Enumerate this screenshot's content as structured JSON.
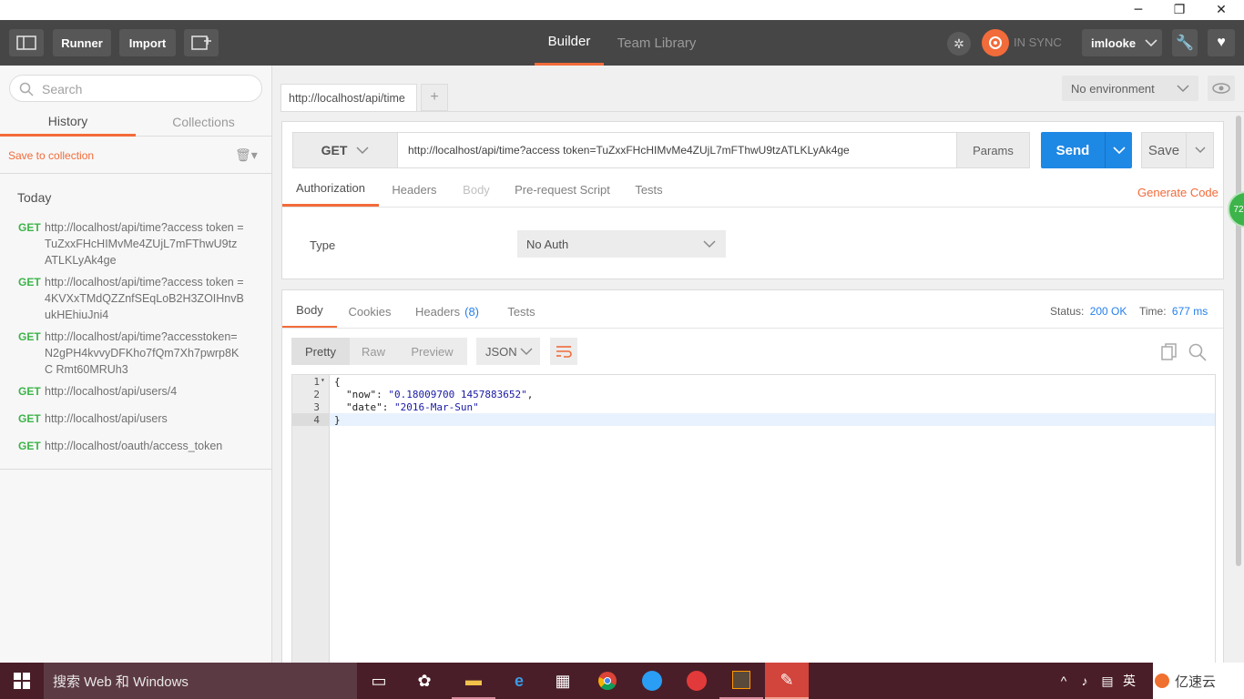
{
  "window": {
    "minimize": "─",
    "maximize": "❐",
    "close": "✕"
  },
  "header": {
    "runner": "Runner",
    "import": "Import",
    "tab_builder": "Builder",
    "tab_team_library": "Team Library",
    "sync": "IN SYNC",
    "user": "imlooke"
  },
  "sidebar": {
    "search_placeholder": "Search",
    "tab_history": "History",
    "tab_collections": "Collections",
    "save_to_collection": "Save to collection",
    "group_today": "Today",
    "items": [
      {
        "method": "GET",
        "url": "http://localhost/api/time?access token =TuZxxFHcHIMvMe4ZUjL7mFThwU9tz ATLKLyAk4ge"
      },
      {
        "method": "GET",
        "url": "http://localhost/api/time?access token =4KVXxTMdQZZnfSEqLoB2H3ZOIHnvB ukHEhiuJni4"
      },
      {
        "method": "GET",
        "url": "http://localhost/api/time?accesstoken= N2gPH4kvvyDFKho7fQm7Xh7pwrp8KC Rmt60MRUh3"
      },
      {
        "method": "GET",
        "url": "http://localhost/api/users/4"
      },
      {
        "method": "GET",
        "url": "http://localhost/api/users"
      },
      {
        "method": "GET",
        "url": "http://localhost/oauth/access_token"
      }
    ]
  },
  "request": {
    "tab_label": "http://localhost/api/time",
    "add_tab": "+",
    "environment": "No environment",
    "method": "GET",
    "url": "http://localhost/api/time?access token=TuZxxFHcHIMvMe4ZUjL7mFThwU9tzATLKLyAk4ge",
    "params": "Params",
    "send": "Send",
    "save": "Save",
    "tabs": {
      "authorization": "Authorization",
      "headers": "Headers",
      "body": "Body",
      "prerequest": "Pre-request Script",
      "tests": "Tests"
    },
    "generate_code": "Generate Code",
    "type_label": "Type",
    "auth_type": "No Auth"
  },
  "response": {
    "tabs": {
      "body": "Body",
      "cookies": "Cookies",
      "headers": "Headers",
      "headers_count": "(8)",
      "tests": "Tests"
    },
    "status_label": "Status:",
    "status_value": "200 OK",
    "time_label": "Time:",
    "time_value": "677 ms",
    "view_pretty": "Pretty",
    "view_raw": "Raw",
    "view_preview": "Preview",
    "format": "JSON",
    "lines": [
      {
        "num": "1",
        "text": "{"
      },
      {
        "num": "2",
        "key": "\"now\"",
        "sep": ": ",
        "val": "\"0.18009700 1457883652\"",
        "end": ","
      },
      {
        "num": "3",
        "key": "\"date\"",
        "sep": ": ",
        "val": "\"2016-Mar-Sun\"",
        "end": ""
      },
      {
        "num": "4",
        "text": "}"
      }
    ]
  },
  "taskbar": {
    "search": "搜索 Web 和 Windows",
    "ime": "英",
    "watermark": "亿速云"
  },
  "colors": {
    "accent": "#f26b3a",
    "send": "#1e88e5",
    "green": "#3db449",
    "header": "#464646",
    "link": "#2680eb"
  }
}
